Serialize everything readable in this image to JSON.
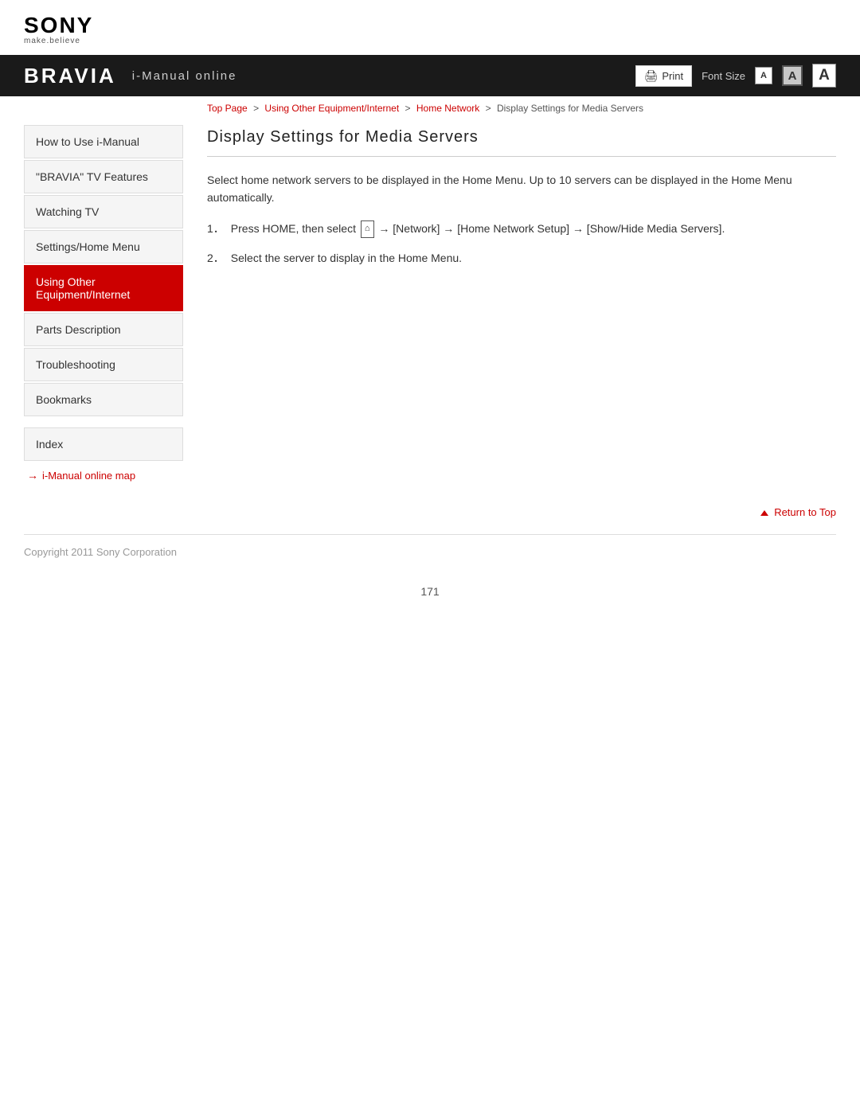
{
  "sony": {
    "logo": "SONY",
    "tagline": "make.believe"
  },
  "bravia_bar": {
    "logo": "BRAVIA",
    "subtitle": "i-Manual online",
    "print_label": "Print",
    "font_size_label": "Font Size",
    "font_small": "A",
    "font_medium": "A",
    "font_large": "A"
  },
  "breadcrumb": {
    "top_page": "Top Page",
    "sep1": ">",
    "link2": "Using Other Equipment/Internet",
    "sep2": ">",
    "link3": "Home Network",
    "sep3": ">",
    "current": "Display Settings for Media Servers"
  },
  "sidebar": {
    "items": [
      {
        "label": "How to Use i-Manual",
        "active": false
      },
      {
        "label": "\"BRAVIA\" TV Features",
        "active": false
      },
      {
        "label": "Watching TV",
        "active": false
      },
      {
        "label": "Settings/Home Menu",
        "active": false
      },
      {
        "label": "Using Other Equipment/Internet",
        "active": true
      },
      {
        "label": "Parts Description",
        "active": false
      },
      {
        "label": "Troubleshooting",
        "active": false
      },
      {
        "label": "Bookmarks",
        "active": false
      }
    ],
    "index_label": "Index",
    "map_link": "i-Manual online map"
  },
  "content": {
    "title": "Display Settings for Media Servers",
    "intro": "Select home network servers to be displayed in the Home Menu. Up to 10 servers can be displayed in the Home Menu automatically.",
    "steps": [
      {
        "num": "1．",
        "text": "Press HOME, then select",
        "icon": true,
        "text_after": "→ [Network] → [Home Network Setup] → [Show/Hide Media Servers]."
      },
      {
        "num": "2．",
        "text": "Select the server to display in the Home Menu."
      }
    ]
  },
  "return_top": "Return to Top",
  "footer": {
    "copyright": "Copyright 2011 Sony Corporation"
  },
  "page_number": "171"
}
